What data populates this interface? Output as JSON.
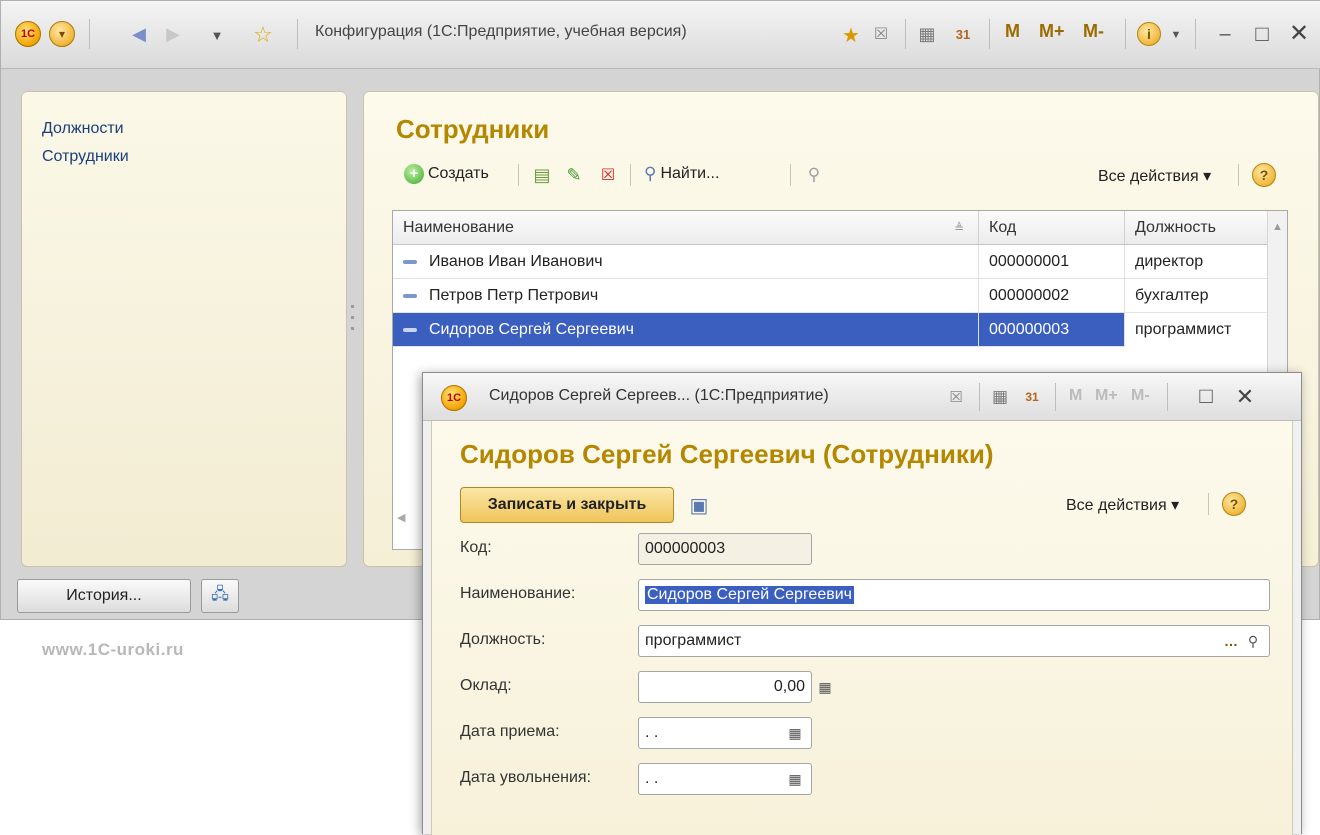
{
  "window": {
    "title": "Конфигурация  (1С:Предприятие, учебная версия)",
    "m_label": "M",
    "mplus_label": "M+",
    "mminus_label": "M-"
  },
  "left_nav": {
    "items": [
      {
        "label": "Должности"
      },
      {
        "label": "Сотрудники"
      }
    ]
  },
  "list_form": {
    "title": "Сотрудники",
    "create_label": "Создать",
    "find_label": "Найти...",
    "all_actions_label": "Все действия ▾",
    "columns": [
      "Наименование",
      "Код",
      "Должность"
    ],
    "rows": [
      {
        "name": "Иванов Иван Иванович",
        "code": "000000001",
        "position": "директор"
      },
      {
        "name": "Петров Петр Петрович",
        "code": "000000002",
        "position": "бухгалтер"
      },
      {
        "name": "Сидоров Сергей Сергеевич",
        "code": "000000003",
        "position": "программист"
      }
    ]
  },
  "bottom": {
    "history_label": "История...",
    "watermark": "www.1C-uroki.ru"
  },
  "dialog": {
    "title": "Сидоров Сергей Сергеев...  (1С:Предприятие)",
    "heading": "Сидоров Сергей Сергеевич (Сотрудники)",
    "save_close_label": "Записать и закрыть",
    "all_actions_label": "Все действия ▾",
    "m_label": "M",
    "mplus_label": "M+",
    "mminus_label": "M-",
    "fields": {
      "code": {
        "label": "Код:",
        "value": "000000003"
      },
      "name": {
        "label": "Наименование:",
        "value": "Сидоров Сергей Сергеевич"
      },
      "position": {
        "label": "Должность:",
        "value": "программист"
      },
      "salary": {
        "label": "Оклад:",
        "value": "0,00"
      },
      "hire_date": {
        "label": "Дата приема:",
        "value": " .  ."
      },
      "dismissal_date": {
        "label": "Дата увольнения:",
        "value": " .  ."
      }
    }
  },
  "colors": {
    "title_accent": "#b48700",
    "selection": "#3b5fbf",
    "link": "#1a3e7a"
  }
}
